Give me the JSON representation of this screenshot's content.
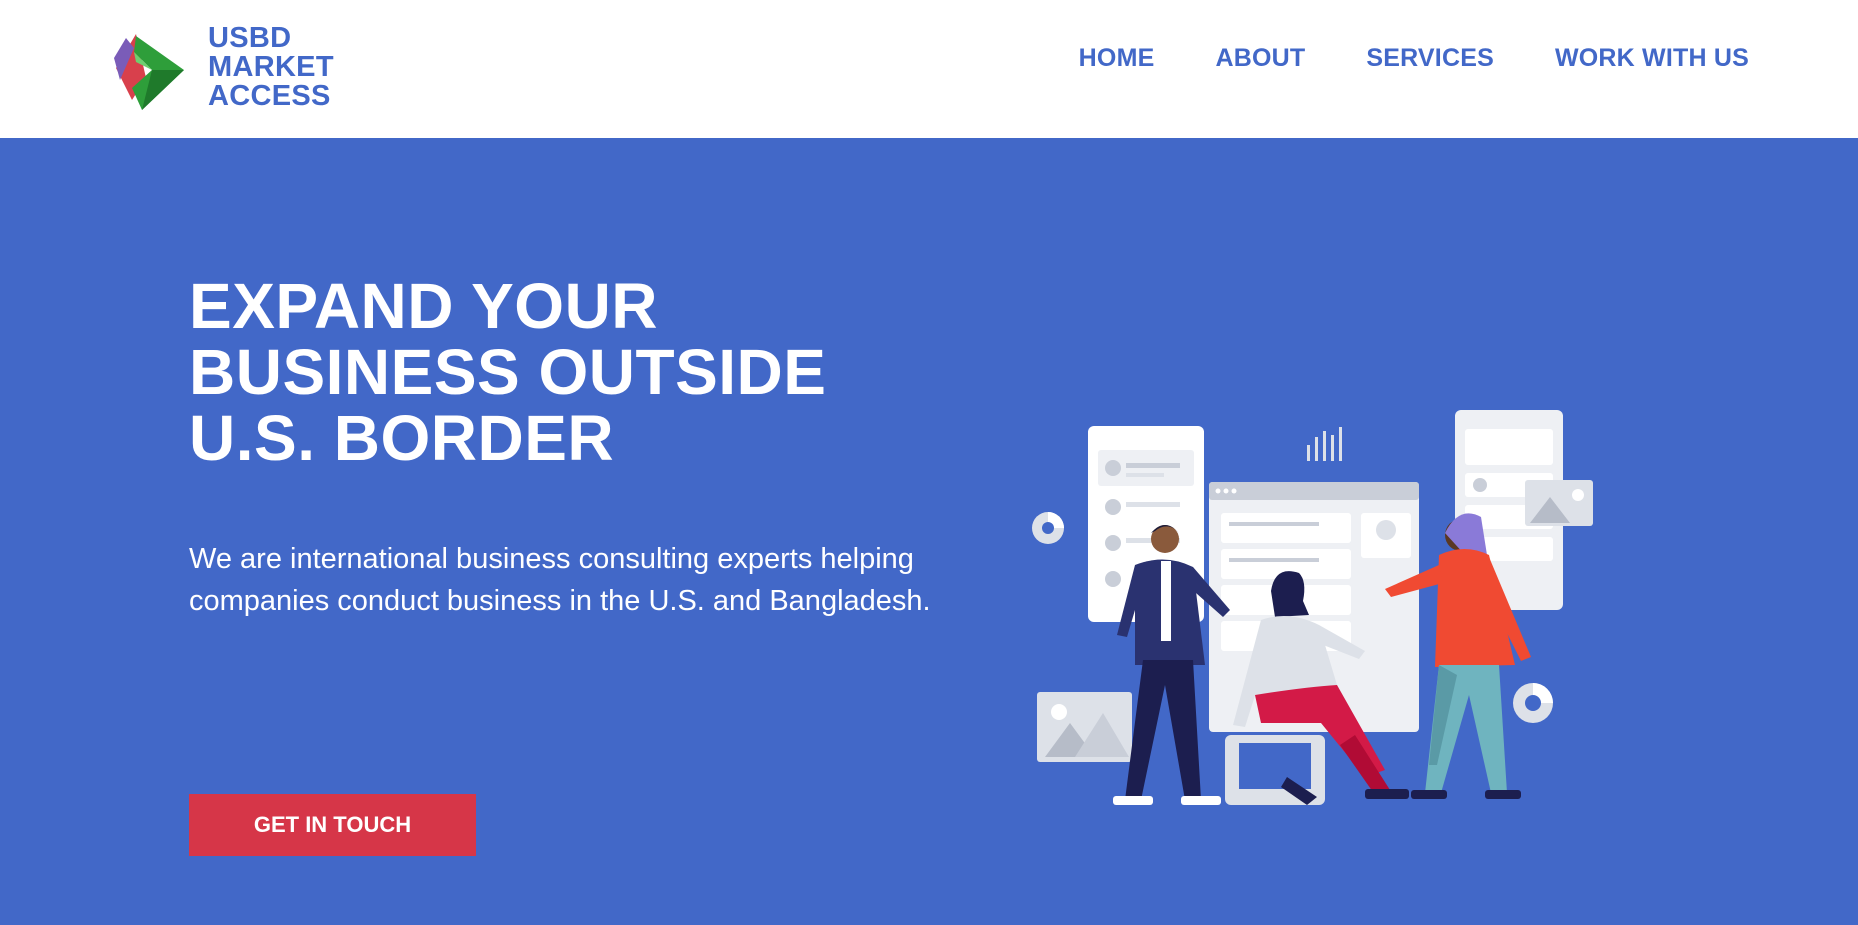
{
  "brand": {
    "logo_lines": [
      "USBD",
      "MARKET",
      "ACCESS"
    ],
    "color": "#4268c8"
  },
  "nav": {
    "items": [
      {
        "label": "HOME"
      },
      {
        "label": "ABOUT"
      },
      {
        "label": "SERVICES"
      },
      {
        "label": "WORK WITH US"
      }
    ]
  },
  "hero": {
    "headline_lines": [
      "EXPAND YOUR",
      "BUSINESS OUTSIDE",
      "U.S. BORDER"
    ],
    "subtext_lines": [
      "We are international business consulting experts helping",
      "companies conduct business in the U.S. and Bangladesh."
    ],
    "cta_label": "GET IN TOUCH",
    "background_color": "#4268c8",
    "cta_color": "#d63648"
  },
  "illustration": {
    "icon": "team-collaboration-illustration"
  }
}
